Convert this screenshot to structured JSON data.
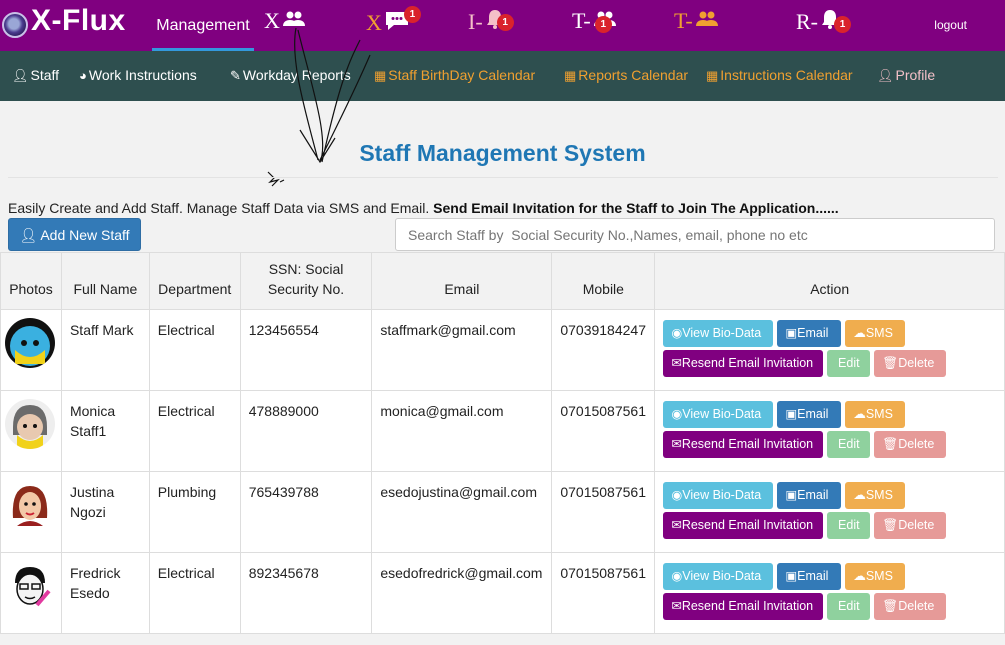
{
  "topbar": {
    "brand": "X-Flux",
    "management": "Management",
    "nav": [
      {
        "label": "X",
        "icon": "users-icon",
        "color": "#ffffff"
      },
      {
        "label": "X",
        "icon": "comment-icon",
        "color": "#f0a030",
        "badge": "1"
      },
      {
        "label": "I-",
        "icon": "bell-icon",
        "color": "#f4c0c8",
        "badge": "1"
      },
      {
        "label": "T-",
        "icon": "users-icon",
        "color": "#ffffff",
        "badge": "1"
      },
      {
        "label": "T-",
        "icon": "users-icon",
        "color": "#f0a030"
      },
      {
        "label": "R-",
        "icon": "bell-icon",
        "color": "#ffffff",
        "badge": "1"
      }
    ],
    "logout": "logout"
  },
  "subnav": {
    "staff": "Staff",
    "work_instructions": "Work Instructions",
    "workday_reports": "Workday Reports",
    "birthday_calendar": "Staff BirthDay Calendar",
    "reports_calendar": "Reports Calendar",
    "instructions_calendar": "Instructions Calendar",
    "profile": "Profile"
  },
  "page": {
    "title": "Staff Management System",
    "intro_text": "Easily Create and Add Staff. Manage Staff Data via SMS and Email.",
    "intro_bold": "Send Email Invitation for the Staff to Join The Application......",
    "add_button": "Add New Staff",
    "search_placeholder": "Search Staff by  Social Security No.,Names, email, phone no etc"
  },
  "table": {
    "headers": {
      "photos": "Photos",
      "full_name": "Full Name",
      "department": "Department",
      "ssn": "SSN: Social Security No.",
      "email": "Email",
      "mobile": "Mobile",
      "action": "Action"
    },
    "actions": {
      "view": "View Bio-Data",
      "email": "Email",
      "sms": "SMS",
      "resend": "Resend Email Invitation",
      "edit": "Edit",
      "delete": "Delete"
    },
    "rows": [
      {
        "name": "Staff Mark",
        "department": "Electrical",
        "ssn": "123456554",
        "email": "staffmark@gmail.com",
        "mobile": "07039184247"
      },
      {
        "name": "Monica Staff1",
        "department": "Electrical",
        "ssn": "478889000",
        "email": "monica@gmail.com",
        "mobile": "07015087561"
      },
      {
        "name": "Justina Ngozi",
        "department": "Plumbing",
        "ssn": "765439788",
        "email": "esedojustina@gmail.com",
        "mobile": "07015087561"
      },
      {
        "name": "Fredrick Esedo",
        "department": "Electrical",
        "ssn": "892345678",
        "email": "esedofredrick@gmail.com",
        "mobile": "07015087561"
      }
    ]
  }
}
